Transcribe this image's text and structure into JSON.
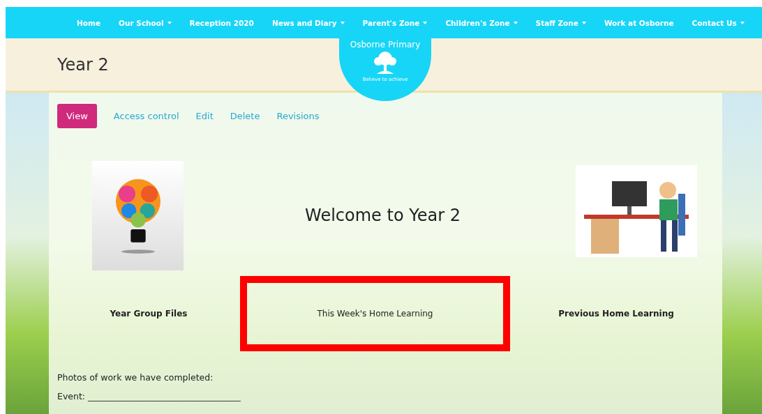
{
  "nav": [
    {
      "label": "Home",
      "dropdown": false
    },
    {
      "label": "Our School",
      "dropdown": true
    },
    {
      "label": "Reception 2020",
      "dropdown": false
    },
    {
      "label": "News and Diary",
      "dropdown": true
    },
    {
      "label": "Parent's Zone",
      "dropdown": true
    },
    {
      "label": "Children's Zone",
      "dropdown": true
    },
    {
      "label": "Staff Zone",
      "dropdown": true
    },
    {
      "label": "Work at Osborne",
      "dropdown": false
    },
    {
      "label": "Contact Us",
      "dropdown": true
    }
  ],
  "logo": {
    "name": "Osborne Primary",
    "motto": "Believe to achieve"
  },
  "page_title": "Year 2",
  "tabs": [
    {
      "label": "View",
      "selected": true
    },
    {
      "label": "Access control",
      "selected": false
    },
    {
      "label": "Edit",
      "selected": false
    },
    {
      "label": "Delete",
      "selected": false
    },
    {
      "label": "Revisions",
      "selected": false
    }
  ],
  "heading": "Welcome to Year 2",
  "links": [
    {
      "label": "Year Group Files",
      "highlighted": false
    },
    {
      "label": "This Week's Home Learning",
      "highlighted": true
    },
    {
      "label": "Previous Home Learning",
      "highlighted": false
    }
  ],
  "photos_label": "Photos of work we have completed:",
  "event_line": "Event: ___________________________________"
}
